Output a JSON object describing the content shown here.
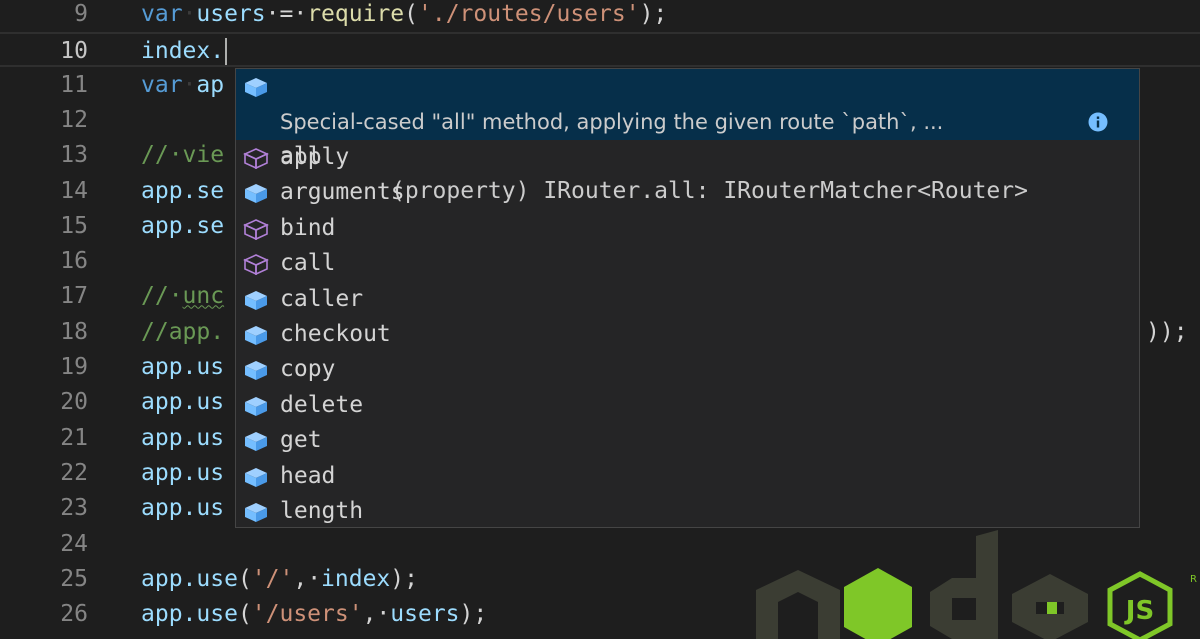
{
  "editor": {
    "lines": [
      {
        "num": "9",
        "segments": [
          {
            "text": "var",
            "color": "#569cd6"
          },
          {
            "text": "·",
            "color": "#3b3b3b"
          },
          {
            "text": "users",
            "color": "#9cdcfe"
          },
          {
            "text": "·=·",
            "color": "#d4d4d4"
          },
          {
            "text": "require",
            "color": "#dcdcaa"
          },
          {
            "text": "(",
            "color": "#d4d4d4"
          },
          {
            "text": "'./routes/users'",
            "color": "#ce9178"
          },
          {
            "text": ");",
            "color": "#d4d4d4"
          }
        ]
      },
      {
        "num": "10",
        "segments": [
          {
            "text": "index.",
            "color": "#9cdcfe"
          }
        ]
      },
      {
        "num": "11",
        "segments": [
          {
            "text": "var",
            "color": "#569cd6"
          },
          {
            "text": "·",
            "color": "#3b3b3b"
          },
          {
            "text": "ap",
            "color": "#9cdcfe"
          }
        ]
      },
      {
        "num": "12",
        "segments": []
      },
      {
        "num": "13",
        "segments": [
          {
            "text": "//·vie",
            "color": "#6a9955"
          }
        ]
      },
      {
        "num": "14",
        "segments": [
          {
            "text": "app.se",
            "color": "#9cdcfe"
          }
        ]
      },
      {
        "num": "15",
        "segments": [
          {
            "text": "app.se",
            "color": "#9cdcfe"
          }
        ]
      },
      {
        "num": "16",
        "segments": []
      },
      {
        "num": "17",
        "segments": [
          {
            "text": "//·",
            "color": "#6a9955"
          },
          {
            "text": "unc",
            "color": "#6a9955"
          }
        ]
      },
      {
        "num": "18",
        "segments": [
          {
            "text": "//app.",
            "color": "#6a9955"
          }
        ],
        "tail": "));"
      },
      {
        "num": "19",
        "segments": [
          {
            "text": "app.us",
            "color": "#9cdcfe"
          }
        ]
      },
      {
        "num": "20",
        "segments": [
          {
            "text": "app.us",
            "color": "#9cdcfe"
          }
        ]
      },
      {
        "num": "21",
        "segments": [
          {
            "text": "app.us",
            "color": "#9cdcfe"
          }
        ]
      },
      {
        "num": "22",
        "segments": [
          {
            "text": "app.us",
            "color": "#9cdcfe"
          }
        ]
      },
      {
        "num": "23",
        "segments": [
          {
            "text": "app.us",
            "color": "#9cdcfe"
          }
        ]
      },
      {
        "num": "24",
        "segments": []
      },
      {
        "num": "25",
        "segments": [
          {
            "text": "app.use",
            "color": "#9cdcfe"
          },
          {
            "text": "(",
            "color": "#d4d4d4"
          },
          {
            "text": "'/'",
            "color": "#ce9178"
          },
          {
            "text": ",·",
            "color": "#d4d4d4"
          },
          {
            "text": "index",
            "color": "#9cdcfe"
          },
          {
            "text": ");",
            "color": "#d4d4d4"
          }
        ]
      },
      {
        "num": "26",
        "segments": [
          {
            "text": "app.use",
            "color": "#9cdcfe"
          },
          {
            "text": "(",
            "color": "#d4d4d4"
          },
          {
            "text": "'/users'",
            "color": "#ce9178"
          },
          {
            "text": ",·",
            "color": "#d4d4d4"
          },
          {
            "text": "users",
            "color": "#9cdcfe"
          },
          {
            "text": ");",
            "color": "#d4d4d4"
          }
        ]
      }
    ]
  },
  "suggest": {
    "selected": {
      "label": "all",
      "detail": "(property) IRouter.all: IRouterMatcher<Router>",
      "doc": "Special-cased \"all\" method, applying the given route `path`, ...",
      "icon": "property-icon"
    },
    "items": [
      {
        "label": "apply",
        "icon": "method-icon"
      },
      {
        "label": "arguments",
        "icon": "property-icon"
      },
      {
        "label": "bind",
        "icon": "method-icon"
      },
      {
        "label": "call",
        "icon": "method-icon"
      },
      {
        "label": "caller",
        "icon": "property-icon"
      },
      {
        "label": "checkout",
        "icon": "property-icon"
      },
      {
        "label": "copy",
        "icon": "property-icon"
      },
      {
        "label": "delete",
        "icon": "property-icon"
      },
      {
        "label": "get",
        "icon": "property-icon"
      },
      {
        "label": "head",
        "icon": "property-icon"
      },
      {
        "label": "length",
        "icon": "property-icon"
      }
    ]
  },
  "logo": {
    "text": "node",
    "badge": "JS",
    "mark": "R"
  },
  "colors": {
    "node_green": "#7fc728",
    "logo_gray": "#3b3d33",
    "property_icon": "#75beff",
    "method_icon": "#b180d7"
  }
}
